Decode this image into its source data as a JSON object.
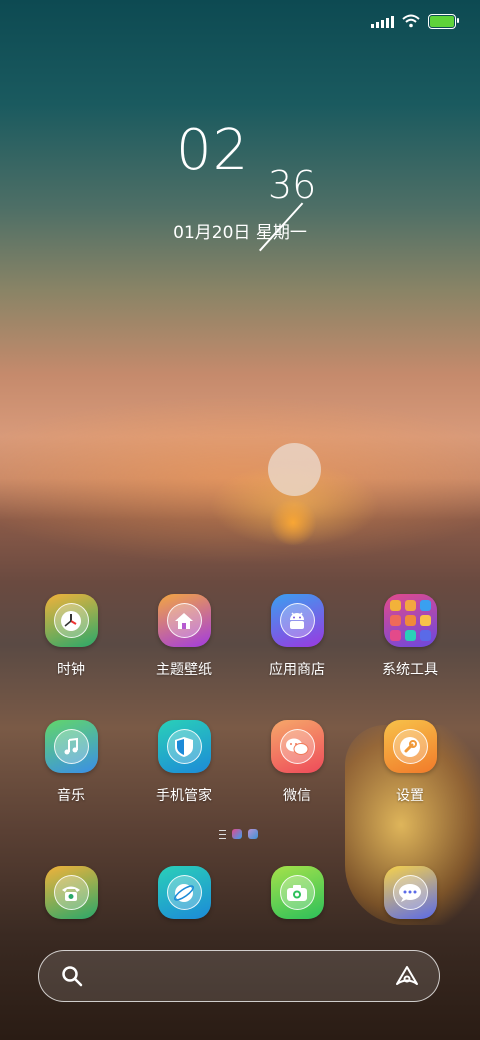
{
  "status_bar": {
    "signal_icon": "signal-bars",
    "wifi_icon": "wifi",
    "battery_icon": "battery-full",
    "battery_color": "#5ed33a"
  },
  "clock": {
    "hour": "02",
    "minute": "36",
    "date": "01月20日 星期一"
  },
  "apps_row1": [
    {
      "label": "时钟",
      "icon": "clock-icon",
      "colors": [
        "#f2b23a",
        "#2aa86a"
      ]
    },
    {
      "label": "主题壁纸",
      "icon": "home-icon",
      "colors": [
        "#f3a740",
        "#a23be0"
      ]
    },
    {
      "label": "应用商店",
      "icon": "android-icon",
      "colors": [
        "#3aa0f0",
        "#9a38e0"
      ]
    },
    {
      "label": "系统工具",
      "icon": "folder-icon",
      "colors": [
        "#e34a8a",
        "#6a48e0"
      ]
    }
  ],
  "apps_row2": [
    {
      "label": "音乐",
      "icon": "music-note-icon",
      "colors": [
        "#62d66a",
        "#3a8ee8"
      ]
    },
    {
      "label": "手机管家",
      "icon": "shield-icon",
      "colors": [
        "#2ad0b8",
        "#1c8ad8"
      ]
    },
    {
      "label": "微信",
      "icon": "wechat-icon",
      "colors": [
        "#f6a86a",
        "#ee4a5a"
      ]
    },
    {
      "label": "设置",
      "icon": "wrench-icon",
      "colors": [
        "#f7c24a",
        "#f17a2a"
      ]
    }
  ],
  "dock": [
    {
      "icon": "phone-icon",
      "colors": [
        "#f2b23a",
        "#2aa86a"
      ]
    },
    {
      "icon": "browser-icon",
      "colors": [
        "#2ad0b8",
        "#1c8ad8"
      ]
    },
    {
      "icon": "camera-icon",
      "colors": [
        "#a6e24a",
        "#2cc05a"
      ]
    },
    {
      "icon": "message-icon",
      "colors": [
        "#f7d24a",
        "#5a6ae8"
      ]
    }
  ],
  "search_bar": {
    "search_icon": "search-icon",
    "assistant_icon": "assistant-icon"
  }
}
